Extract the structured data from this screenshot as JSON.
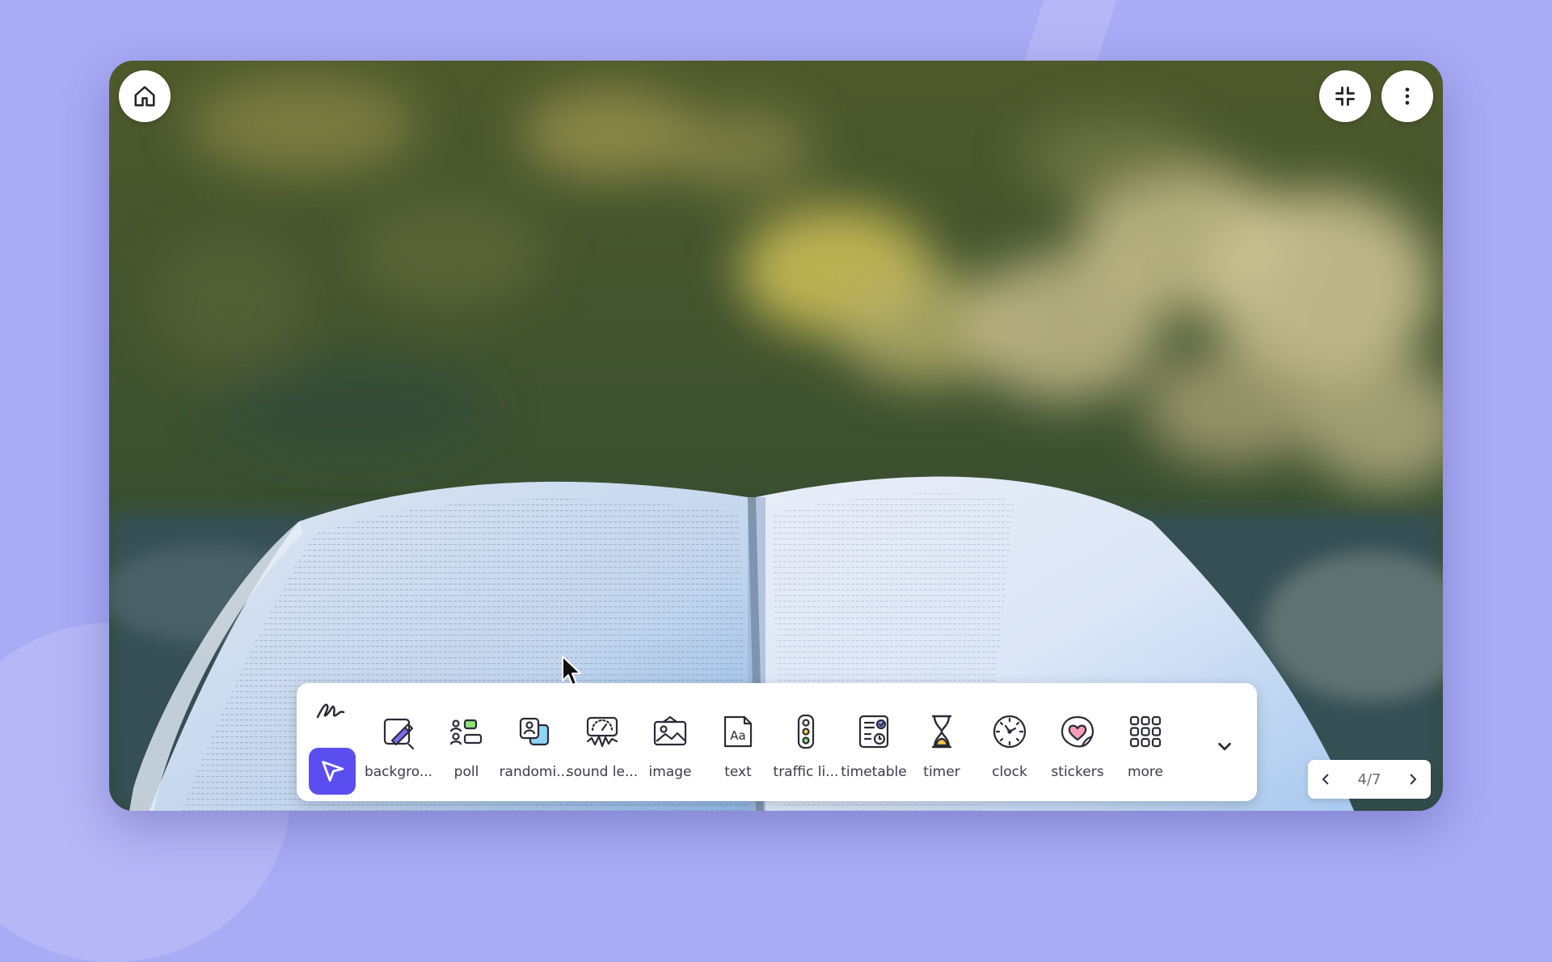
{
  "colors": {
    "page_background": "#a9abf5",
    "accent": "#5b4ef0",
    "icon_stroke": "#2b2b36"
  },
  "top_controls": {
    "home": {
      "icon": "home-icon"
    },
    "collapse": {
      "icon": "collapse-fullscreen-icon"
    },
    "more": {
      "icon": "more-vertical-icon"
    }
  },
  "toolbar": {
    "draw_tool": {
      "icon": "scribble-icon"
    },
    "select_tool": {
      "icon": "cursor-arrow-icon"
    },
    "tools": [
      {
        "label": "backgro...",
        "icon": "background-icon"
      },
      {
        "label": "poll",
        "icon": "poll-icon"
      },
      {
        "label": "randomi...",
        "icon": "randomizer-icon"
      },
      {
        "label": "sound le...",
        "icon": "sound-level-icon"
      },
      {
        "label": "image",
        "icon": "image-icon"
      },
      {
        "label": "text",
        "icon": "text-icon"
      },
      {
        "label": "traffic li...",
        "icon": "traffic-light-icon"
      },
      {
        "label": "timetable",
        "icon": "timetable-icon"
      },
      {
        "label": "timer",
        "icon": "hourglass-icon"
      },
      {
        "label": "clock",
        "icon": "clock-icon"
      },
      {
        "label": "stickers",
        "icon": "sticker-heart-icon"
      },
      {
        "label": "more",
        "icon": "grid-icon"
      }
    ],
    "expand": {
      "icon": "chevron-down-icon"
    }
  },
  "pager": {
    "label": "4/7",
    "prev_icon": "chevron-left-icon",
    "next_icon": "chevron-right-icon"
  }
}
